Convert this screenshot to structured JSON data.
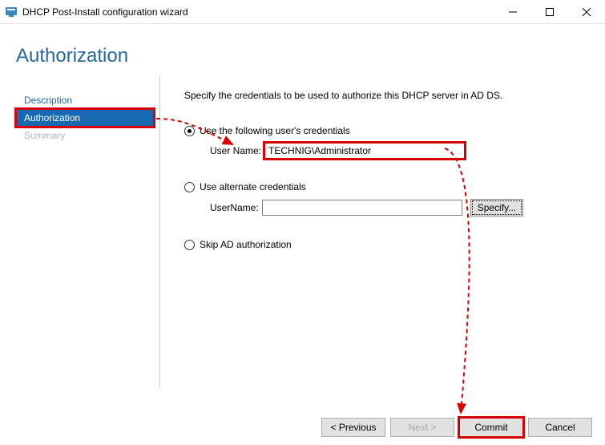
{
  "window": {
    "title": "DHCP Post-Install configuration wizard"
  },
  "header": {
    "title": "Authorization"
  },
  "sidebar": {
    "items": [
      {
        "label": "Description"
      },
      {
        "label": "Authorization"
      },
      {
        "label": "Summary"
      }
    ]
  },
  "content": {
    "instructions": "Specify the credentials to be used to authorize this DHCP server in AD DS.",
    "opt1": {
      "label": "Use the following user's credentials",
      "field_label": "User Name:",
      "value": "TECHNIG\\Administrator"
    },
    "opt2": {
      "label": "Use alternate credentials",
      "field_label": "UserName:",
      "value": "",
      "specify_label": "Specify..."
    },
    "opt3": {
      "label": "Skip AD authorization"
    }
  },
  "footer": {
    "previous": "< Previous",
    "next": "Next >",
    "commit": "Commit",
    "cancel": "Cancel"
  }
}
